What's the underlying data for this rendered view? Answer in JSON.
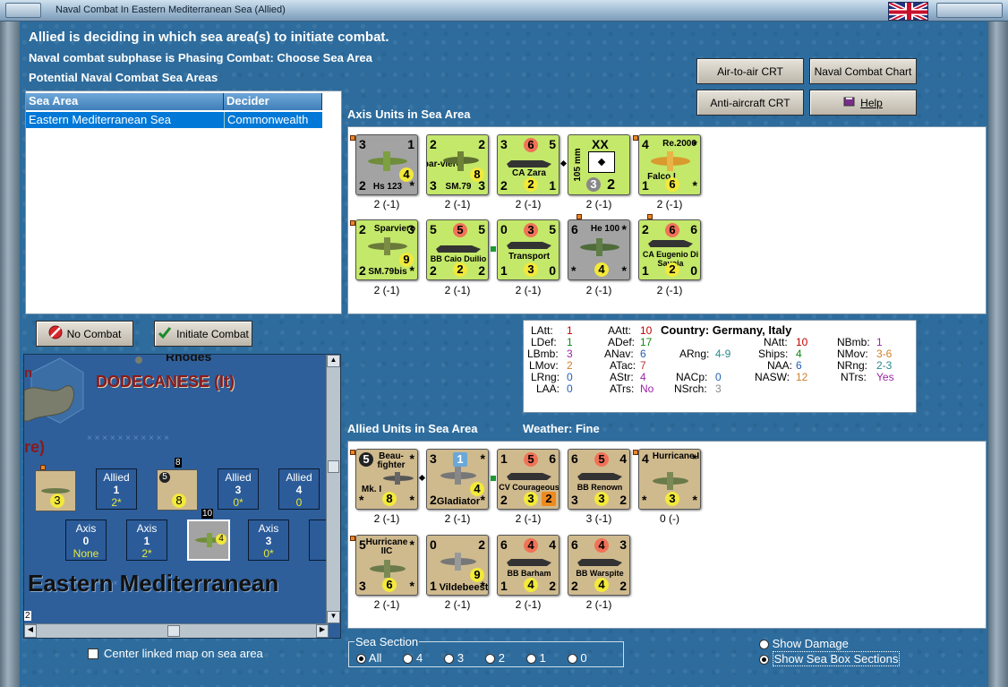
{
  "window": {
    "title": "Naval Combat In Eastern Mediterranean Sea (Allied)"
  },
  "header": {
    "line1": "Allied is deciding in which sea area(s) to initiate combat.",
    "line2": "Naval combat subphase is Phasing Combat: Choose Sea Area",
    "line3": "Potential Naval Combat Sea Areas"
  },
  "buttons": {
    "air_to_air": "Air-to-air CRT",
    "naval_chart": "Naval Combat Chart",
    "anti_aircraft": "Anti-aircraft CRT",
    "help": "Help",
    "no_combat": "No Combat",
    "initiate_combat": "Initiate Combat"
  },
  "sea_table": {
    "headers": [
      "Sea Area",
      "Decider"
    ],
    "rows": [
      [
        "Eastern Mediterranean Sea",
        "Commonwealth"
      ]
    ]
  },
  "axis": {
    "title": "Axis Units in Sea Area",
    "units": [
      {
        "name": "Hs 123",
        "tl": "3",
        "tr": "1",
        "bl": "2",
        "br": "*",
        "mid": "4",
        "label": "2 (-1)"
      },
      {
        "name": "SM.79",
        "sub": "Spar-viero",
        "tl": "2",
        "tr": "2",
        "bl": "3",
        "br": "3",
        "mid": "8",
        "label": "2 (-1)"
      },
      {
        "name": "CA Zara",
        "tl": "3",
        "tm": "6",
        "tr": "5",
        "bl": "2",
        "bm": "2",
        "br": "1",
        "label": "2 (-1)"
      },
      {
        "name": "105 mm",
        "tl": "XX",
        "bl": "3",
        "br": "2",
        "label": "2 (-1)"
      },
      {
        "name": "Falco I",
        "sub": "Re.2000",
        "tl": "4",
        "tr": "*",
        "bl": "1",
        "bm": "6",
        "br": "*",
        "label": "2 (-1)"
      },
      {
        "name": "SM.79bis",
        "sub": "Sparviero",
        "tl": "2",
        "tr": "3",
        "bl": "2",
        "br": "*",
        "mid": "9",
        "label": "2 (-1)"
      },
      {
        "name": "BB Caio Duilio",
        "tl": "5",
        "tm": "5",
        "tr": "5",
        "bl": "2",
        "bm": "2",
        "br": "2",
        "label": "2 (-1)"
      },
      {
        "name": "Transport",
        "tl": "0",
        "tm": "3",
        "tr": "5",
        "bl": "1",
        "bm": "3",
        "br": "0",
        "label": "2 (-1)"
      },
      {
        "name": "He 100",
        "tl": "6",
        "tr": "*",
        "bl": "*",
        "bm": "4",
        "br": "*",
        "label": "2 (-1)"
      },
      {
        "name": "CA Eugenio Di Savoia",
        "tl": "2",
        "tm": "6",
        "tr": "6",
        "bl": "1",
        "bm": "2",
        "br": "0",
        "label": "2 (-1)"
      }
    ]
  },
  "stats": {
    "LAtt_l": "LAtt:",
    "LAtt": "1",
    "LDef_l": "LDef:",
    "LDef": "1",
    "LBmb_l": "LBmb:",
    "LBmb": "3",
    "LMov_l": "LMov:",
    "LMov": "2",
    "LRng_l": "LRng:",
    "LRng": "0",
    "LAA_l": "LAA:",
    "LAA": "0",
    "AAtt_l": "AAtt:",
    "AAtt": "10",
    "ADef_l": "ADef:",
    "ADef": "17",
    "ANav_l": "ANav:",
    "ANav": "6",
    "ATac_l": "ATac:",
    "ATac": "7",
    "AStr_l": "AStr:",
    "AStr": "4",
    "ATrs_l": "ATrs:",
    "ATrs": "No",
    "ARng_l": "ARng:",
    "ARng": "4-9",
    "NACp_l": "NACp:",
    "NACp": "0",
    "NSrch_l": "NSrch:",
    "NSrch": "3",
    "country": "Country: Germany, Italy",
    "NAtt_l": "NAtt:",
    "NAtt": "10",
    "Ships_l": "Ships:",
    "Ships": "4",
    "NAA_l": "NAA:",
    "NAA": "6",
    "NASW_l": "NASW:",
    "NASW": "12",
    "NBmb_l": "NBmb:",
    "NBmb": "1",
    "NMov_l": "NMov:",
    "NMov": "3-6",
    "NRng_l": "NRng:",
    "NRng": "2-3",
    "NTrs_l": "NTrs:",
    "NTrs": "Yes"
  },
  "allied": {
    "title": "Allied Units in Sea Area",
    "weather": "Weather:  Fine",
    "units": [
      {
        "name": "Mk. I",
        "sub": "Beau-fighter",
        "tl": "5",
        "tr": "*",
        "bl": "*",
        "bm": "8",
        "br": "*",
        "label": "2 (-1)"
      },
      {
        "name": "Gladiator",
        "tl": "3",
        "tm": "1",
        "tr": "*",
        "bl": "2",
        "br": "*",
        "mid": "4",
        "label": "2 (-1)"
      },
      {
        "name": "CV Courageous",
        "tl": "1",
        "tm": "5",
        "tr": "6",
        "bl": "2",
        "bm": "3",
        "br": "2",
        "label": "2 (-1)"
      },
      {
        "name": "BB Renown",
        "tl": "6",
        "tm": "5",
        "tr": "4",
        "bl": "3",
        "bm": "3",
        "br": "2",
        "label": "3 (-1)"
      },
      {
        "name": "Hurricane I",
        "tl": "4",
        "tr": "*",
        "bl": "*",
        "bm": "3",
        "br": "*",
        "label": "0 (-)"
      },
      {
        "name": "Hurricane IIC",
        "tl": "5",
        "tr": "*",
        "bl": "3",
        "bm": "6",
        "br": "*",
        "label": "2 (-1)"
      },
      {
        "name": "Vildebeest",
        "tl": "0",
        "tr": "2",
        "bl": "1",
        "br": "*",
        "mid": "9",
        "label": "2 (-1)"
      },
      {
        "name": "BB Barham",
        "tl": "6",
        "tm": "4",
        "tr": "4",
        "bl": "1",
        "bm": "4",
        "br": "2",
        "label": "2 (-1)"
      },
      {
        "name": "BB Warspite",
        "tl": "6",
        "tm": "4",
        "tr": "3",
        "bl": "2",
        "bm": "4",
        "br": "2",
        "label": "2 (-1)"
      }
    ]
  },
  "map": {
    "dodecanese": "DODECANESE (It)",
    "rhodes": "Rhodes",
    "edge_n": "n",
    "edge_re": "re)",
    "sea_name": "Eastern Mediterranean",
    "num8": "8",
    "num10": "10",
    "num2": "2",
    "boxes": [
      {
        "side": "Allied",
        "n": "1",
        "v": "2*"
      },
      {
        "side": "Allied",
        "n": "3",
        "v": "0*"
      },
      {
        "side": "Allied",
        "n": "4",
        "v": "0"
      },
      {
        "side": "Axis",
        "n": "0",
        "v": "None"
      },
      {
        "side": "Axis",
        "n": "1",
        "v": "2*"
      },
      {
        "side": "Axis",
        "n": "3",
        "v": "0*"
      }
    ]
  },
  "options": {
    "center_map": "Center linked map on sea area",
    "sea_section": "Sea Section",
    "sections": [
      "All",
      "4",
      "3",
      "2",
      "1",
      "0"
    ],
    "show_damage": "Show Damage",
    "show_boxes": "Show Sea Box Sections"
  },
  "colors": {
    "axis_counter": "#c4e86a",
    "allied_counter": "#cfba8e",
    "selection": "#0078d7"
  }
}
